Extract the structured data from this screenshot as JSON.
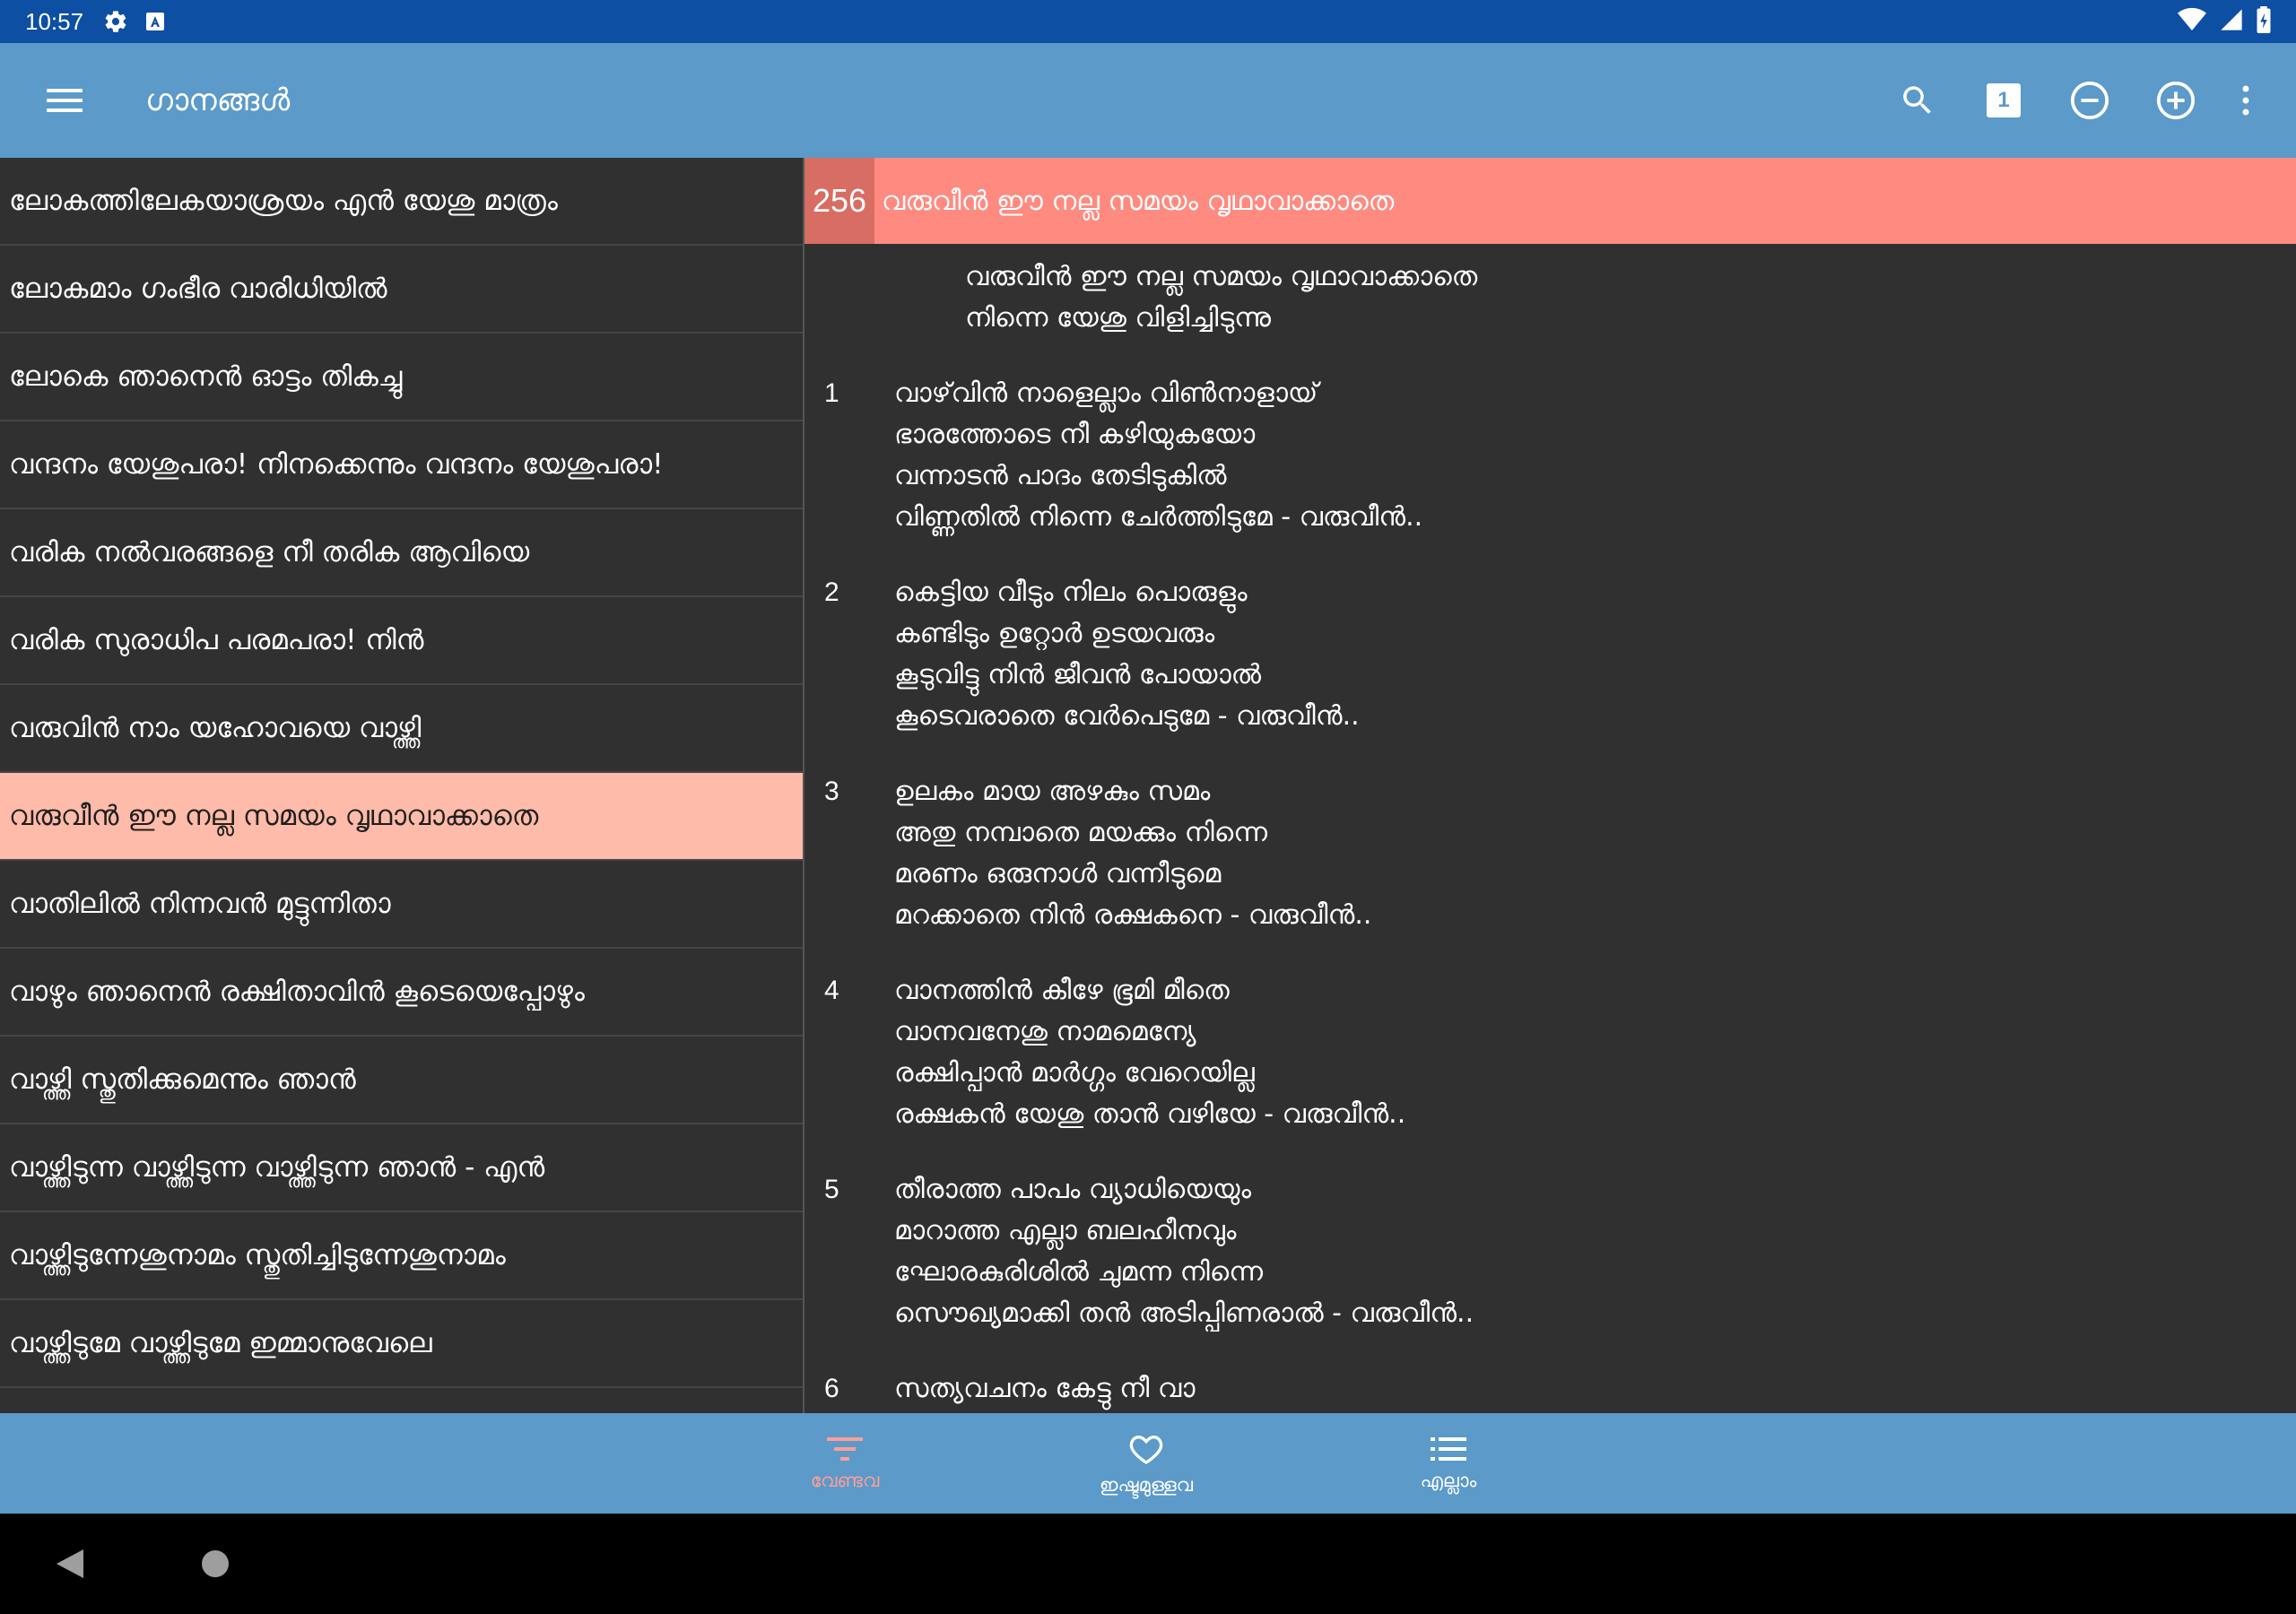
{
  "status": {
    "time": "10:57"
  },
  "app_bar": {
    "title": "ഗാനങ്ങൾ",
    "page_badge": "1"
  },
  "songs": [
    "ലോകത്തിലേകയാശ്രയം എൻ യേശു മാത്രം",
    "ലോകമാം ഗംഭീര വാരിധിയിൽ",
    "ലോകെ ഞാനെൻ ഓട്ടം തികച്ചു",
    "വന്ദനം യേശുപരാ! നിനക്കെന്നും വന്ദനം യേശുപരാ!",
    "വരിക നൽവരങ്ങളെ നീ തരിക ആവിയെ",
    "വരിക സുരാധിപ പരമപരാ! നിൻ",
    "വരുവിൻ നാം യഹോവയെ വാഴ്ത്തി",
    "വരുവീൻ ഈ നല്ല സമയം വൃഥാവാക്കാതെ",
    "വാതിലിൽ നിന്നവൻ മുട്ടുന്നിതാ",
    "വാഴും ഞാനെൻ രക്ഷിതാവിൻ കൂടെയെപ്പോഴും",
    "വാഴ്ത്തി സ്തുതിക്കുമെന്നും ഞാൻ",
    "വാഴ്ത്തിടുന്ന വാഴ്ത്തിടുന്ന വാഴ്ത്തിടുന്ന ഞാൻ - എൻ",
    "വാഴ്ത്തിടുന്നേശുനാമം സ്തുതിച്ചിടുന്നേശുനാമം",
    "വാഴ്ത്തിടുമേ വാഴ്ത്തിടുമേ ഇമ്മാനുവേലെ"
  ],
  "selected_index": 7,
  "song": {
    "number": "256",
    "title": "വരുവീൻ ഈ നല്ല സമയം വൃഥാവാക്കാതെ",
    "chorus": [
      "വരുവീൻ ഈ നല്ല സമയം വൃഥാവാക്കാതെ",
      "നിന്നെ യേശു വിളിച്ചിടുന്നു"
    ],
    "verses": [
      {
        "num": "1",
        "lines": [
          "വാഴ്‌വിൻ നാളെല്ലാം വിൺനാളായ്",
          "ഭാരത്തോടെ നീ കഴിയുകയോ",
          "വന്നാടൻ പാദം തേടിടുകിൽ",
          "വിണ്ണതിൽ നിന്നെ ചേർത്തിടുമേ - വരുവീൻ.."
        ]
      },
      {
        "num": "2",
        "lines": [
          "കെട്ടിയ വീടും നിലം പൊരുളും",
          "കണ്ടിടും ഉറ്റോർ ഉടയവരും",
          "കൂടുവിട്ടു നിൻ ജീവൻ പോയാൽ",
          "കൂടെവരാതെ വേർപെടുമേ - വരുവീൻ.."
        ]
      },
      {
        "num": "3",
        "lines": [
          "ഉലകം മായ അഴകും സമം",
          "അതു നമ്പാതെ മയക്കും നിന്നെ",
          "മരണം ഒരുനാൾ വന്നീടുമെ",
          "മറക്കാതെ നിൻ രക്ഷകനെ - വരുവീൻ.."
        ]
      },
      {
        "num": "4",
        "lines": [
          "വാനത്തിൻ കീഴേ ഭൂമി മീതെ",
          "വാനവനേശു നാമമെന്യേ",
          "രക്ഷിപ്പാൻ മാർഗ്ഗം വേറെയില്ല",
          "രക്ഷകൻ യേശു താൻ വഴിയേ - വരുവീൻ.."
        ]
      },
      {
        "num": "5",
        "lines": [
          "തീരാത്ത പാപം വ്യാധിയെയും",
          "മാറാത്ത എല്ലാ ബലഹീനവും",
          "ഘോരകുരിശിൽ ചുമന്ന നിന്നെ",
          "സൌഖ്യമാക്കി തൻ അടിപ്പിണരാൽ - വരുവീൻ.."
        ]
      },
      {
        "num": "6",
        "lines": [
          "സത്യവചനം കേട്ടു നീ വാ"
        ]
      }
    ]
  },
  "bottom_nav": {
    "filter_label": "വേണ്ടവ",
    "favorites_label": "ഇഷ്ടമുള്ളവ",
    "all_label": "എല്ലാം"
  },
  "colors": {
    "app_bar": "#5b9ac9",
    "status_bar": "#0d4fa3",
    "selected_item": "#ffbba9",
    "song_header": "#ff8a80",
    "active_nav": "#ff9f95"
  }
}
